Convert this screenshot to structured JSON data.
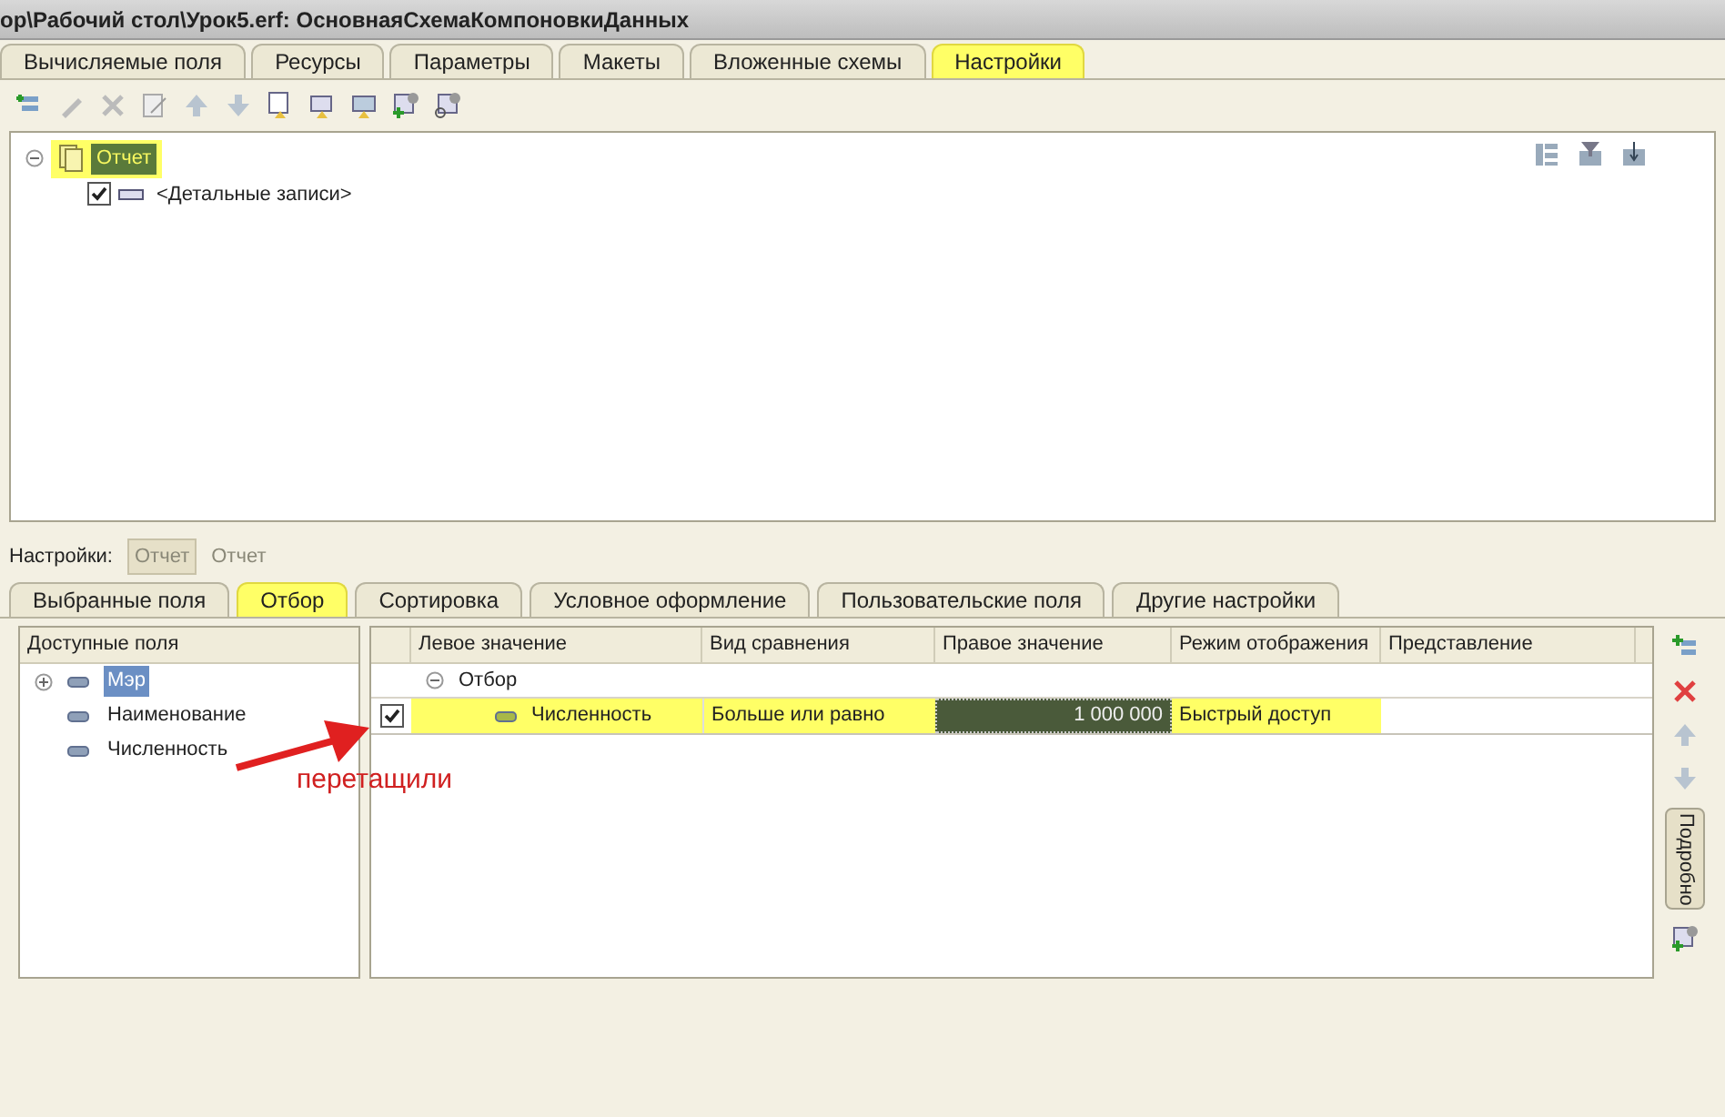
{
  "window": {
    "title": "ор\\Рабочий стол\\Урок5.erf: ОсновнаяСхемаКомпоновкиДанных"
  },
  "tabs": [
    {
      "label": "Вычисляемые поля",
      "selected": false
    },
    {
      "label": "Ресурсы",
      "selected": false
    },
    {
      "label": "Параметры",
      "selected": false
    },
    {
      "label": "Макеты",
      "selected": false
    },
    {
      "label": "Вложенные схемы",
      "selected": false
    },
    {
      "label": "Настройки",
      "selected": true
    }
  ],
  "structure_tree": [
    {
      "label": "Отчет",
      "selected": true,
      "expanded": true,
      "children": [
        {
          "label": "<Детальные записи>",
          "checked": true,
          "selected": false
        }
      ]
    }
  ],
  "settings_bar": {
    "label": "Настройки:",
    "items": [
      {
        "label": "Отчет",
        "selected": true
      },
      {
        "label": "Отчет",
        "selected": false
      }
    ]
  },
  "sub_tabs": [
    {
      "label": "Выбранные поля",
      "selected": false
    },
    {
      "label": "Отбор",
      "selected": true
    },
    {
      "label": "Сортировка",
      "selected": false
    },
    {
      "label": "Условное оформление",
      "selected": false
    },
    {
      "label": "Пользовательские поля",
      "selected": false
    },
    {
      "label": "Другие настройки",
      "selected": false
    }
  ],
  "available_fields": {
    "header": "Доступные поля",
    "items": [
      {
        "label": "Мэр",
        "selected": true,
        "expandable": true
      },
      {
        "label": "Наименование",
        "selected": false,
        "expandable": false
      },
      {
        "label": "Численность",
        "selected": false,
        "expandable": false
      }
    ]
  },
  "filter_table": {
    "columns": [
      "Левое значение",
      "Вид сравнения",
      "Правое значение",
      "Режим отображения",
      "Представление"
    ],
    "group": {
      "label": "Отбор",
      "expanded": true
    },
    "rows": [
      {
        "checked": true,
        "highlighted": true,
        "left": "Численность",
        "comparison": "Больше или равно",
        "right": "1 000 000",
        "mode": "Быстрый доступ",
        "presentation": ""
      }
    ]
  },
  "side_button": "Подробно",
  "annotation": "перетащили"
}
